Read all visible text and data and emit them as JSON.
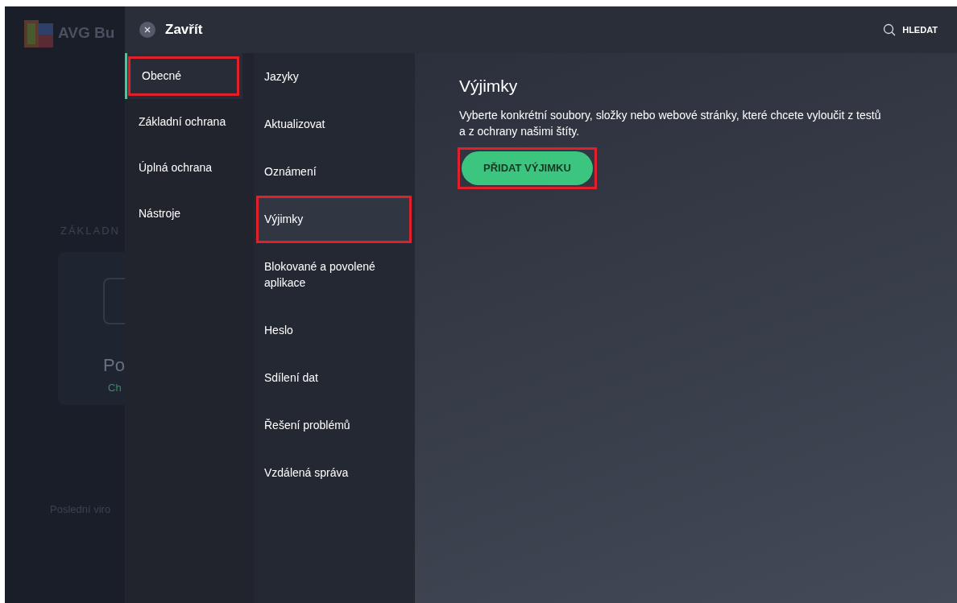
{
  "background_app": {
    "logo": "AVG Bu",
    "section_label": "ZÁKLADN",
    "card_title": "Po",
    "card_status": "Ch",
    "footer_text": "Poslední viro"
  },
  "header": {
    "close_label": "Zavřít",
    "search_label": "HLEDAT"
  },
  "categories": [
    {
      "label": "Obecné",
      "selected": true,
      "highlighted": true
    },
    {
      "label": "Základní ochrana",
      "selected": false,
      "highlighted": false
    },
    {
      "label": "Úplná ochrana",
      "selected": false,
      "highlighted": false
    },
    {
      "label": "Nástroje",
      "selected": false,
      "highlighted": false
    }
  ],
  "subcategories": [
    {
      "label": "Jazyky",
      "selected": false,
      "highlighted": false
    },
    {
      "label": "Aktualizovat",
      "selected": false,
      "highlighted": false
    },
    {
      "label": "Oznámení",
      "selected": false,
      "highlighted": false
    },
    {
      "label": "Výjimky",
      "selected": true,
      "highlighted": true
    },
    {
      "label": "Blokované a povolené aplikace",
      "selected": false,
      "highlighted": false
    },
    {
      "label": "Heslo",
      "selected": false,
      "highlighted": false
    },
    {
      "label": "Sdílení dat",
      "selected": false,
      "highlighted": false
    },
    {
      "label": "Řešení problémů",
      "selected": false,
      "highlighted": false
    },
    {
      "label": "Vzdálená správa",
      "selected": false,
      "highlighted": false
    }
  ],
  "content": {
    "title": "Výjimky",
    "description": "Vyberte konkrétní soubory, složky nebo webové stránky, které chcete vyloučit z testů a z ochrany našimi štíty.",
    "button": {
      "label": "PŘIDAT VÝJIMKU",
      "highlighted": true
    }
  }
}
